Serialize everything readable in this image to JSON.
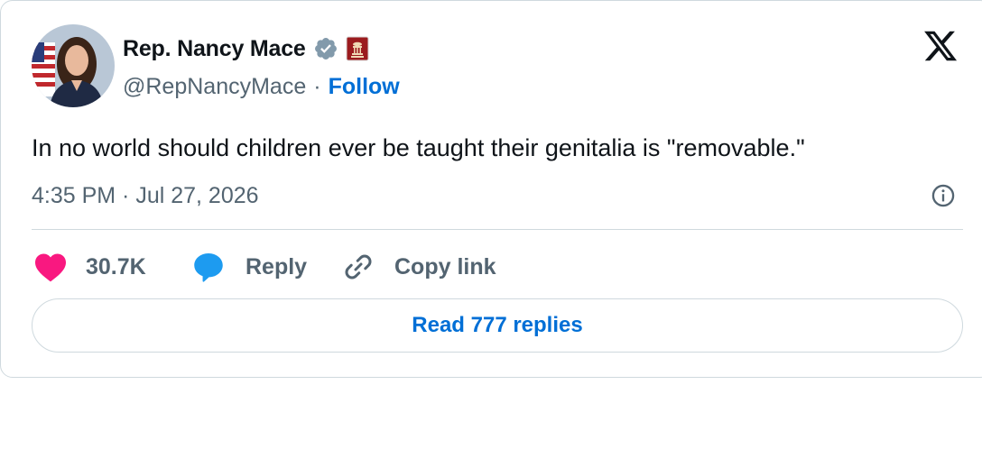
{
  "author": {
    "display_name": "Rep. Nancy Mace",
    "handle": "@RepNancyMace",
    "separator": "·",
    "follow_label": "Follow",
    "avatar_icon": "profile-photo",
    "verified_icon": "verified-badge-icon",
    "affiliation_icon": "us-house-seal-icon"
  },
  "tweet": {
    "text": "In no world should children ever be taught their genitalia is \"removable.\"",
    "timestamp": "4:35 PM · Jul 27, 2026"
  },
  "actions": {
    "like_count": "30.7K",
    "reply_label": "Reply",
    "copy_link_label": "Copy link"
  },
  "footer": {
    "read_replies_label": "Read 777 replies"
  },
  "colors": {
    "text_primary": "#0f1419",
    "text_secondary": "#536471",
    "link_blue": "#006fd6",
    "like_pink": "#f91880",
    "reply_blue": "#1d9bf0",
    "verified_gray": "#829aab",
    "border": "#cfd9de"
  }
}
